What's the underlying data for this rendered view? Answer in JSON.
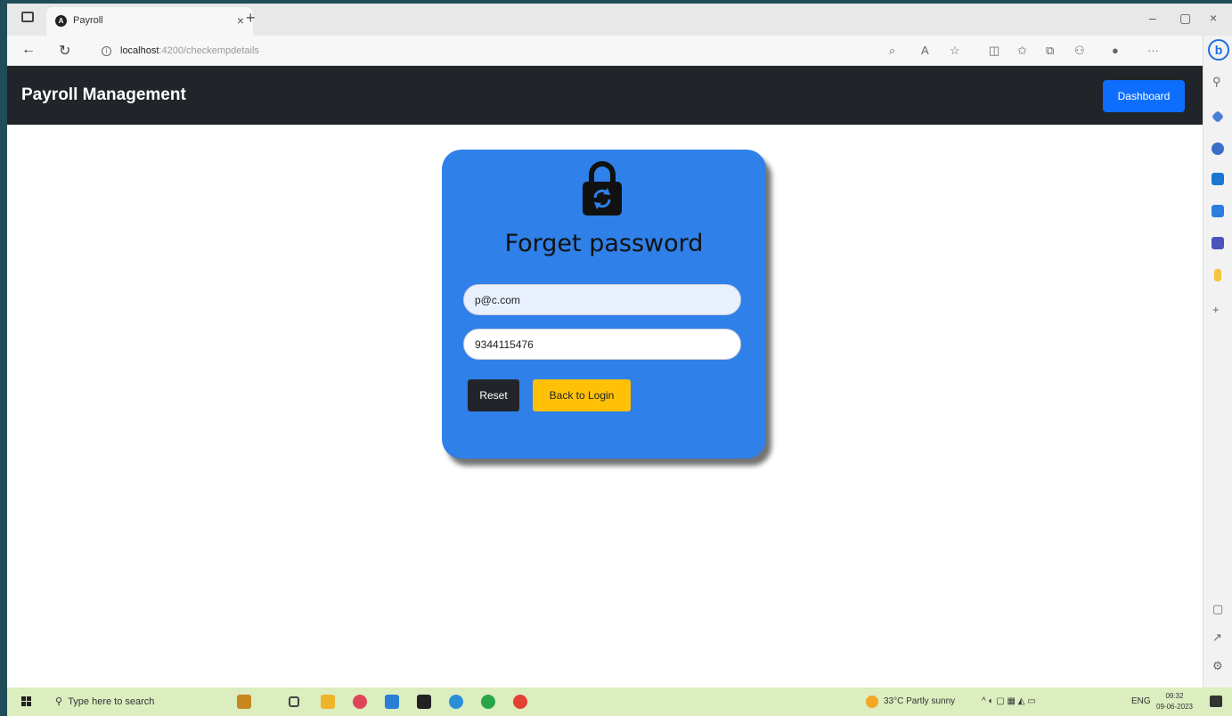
{
  "browser": {
    "tab_title": "Payroll",
    "tab_close": "×",
    "new_tab": "+",
    "url_host": "localhost",
    "url_path": ":4200/checkempdetails",
    "window_controls": [
      "–",
      "▢",
      "×"
    ]
  },
  "navbar": {
    "brand": "Payroll Management",
    "dashboard_button": "Dashboard"
  },
  "card": {
    "icon": "lock-refresh-icon",
    "title": "Forget password",
    "email_value": "p@c.com",
    "phone_value": "9344115476",
    "reset_button": "Reset",
    "back_button": "Back to Login",
    "colors": {
      "card_bg": "#2f80e8",
      "reset_bg": "#212529",
      "back_bg": "#ffc107"
    }
  },
  "taskbar": {
    "search_placeholder": "Type here to search",
    "weather": "33°C  Partly sunny",
    "lang": "ENG",
    "time": "09:32",
    "date": "09-06-2023"
  }
}
